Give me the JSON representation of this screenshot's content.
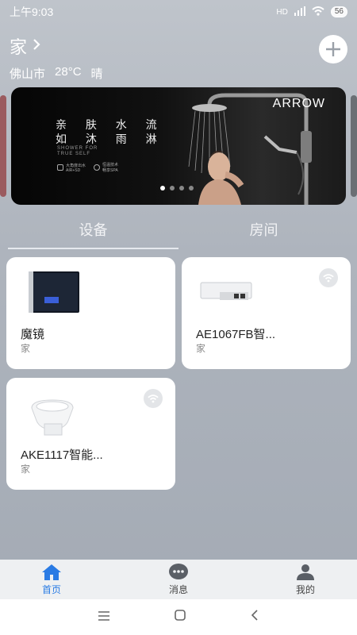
{
  "status": {
    "time": "上午9:03",
    "battery": "56",
    "network": "HD"
  },
  "header": {
    "home_name": "家",
    "city": "佛山市",
    "temperature": "28°C",
    "weather": "晴"
  },
  "banner": {
    "slogan_line1": "亲 肤 水 流",
    "slogan_line2": "如 沐 雨 淋",
    "sub_line1": "SHOWER FOR",
    "sub_line2": "TRUE SELF",
    "badge1": "大角度出水\nAIR+SD",
    "badge2": "恒温技术\n畅享SPA",
    "logo": "ARROW",
    "dots": 4,
    "active_dot": 0
  },
  "tabs": {
    "devices": "设备",
    "rooms": "房间"
  },
  "devices": [
    {
      "name": "魔镜",
      "room": "家",
      "online_icon": false
    },
    {
      "name": "AE1067FB智...",
      "room": "家",
      "online_icon": true
    },
    {
      "name": "AKE1117智能...",
      "room": "家",
      "online_icon": true
    }
  ],
  "nav": {
    "home": "首页",
    "messages": "消息",
    "mine": "我的"
  },
  "colors": {
    "accent": "#2a7be4",
    "card_bg": "#ffffff",
    "page_bg": "#aeb4bd"
  }
}
